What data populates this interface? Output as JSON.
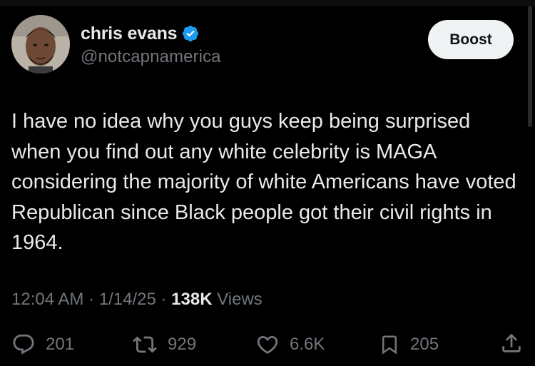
{
  "author": {
    "display_name": "chris evans",
    "handle": "@notcapnamerica",
    "verified": true,
    "verified_color": "#1d9bf0"
  },
  "boost_button": {
    "label": "Boost"
  },
  "tweet": {
    "text": "I have no idea why you guys keep being surprised when you find out any white celebrity is MAGA considering the majority of white Americans have voted Republican since Black people got their civil rights in 1964."
  },
  "meta": {
    "time": "12:04 AM",
    "date": "1/14/25",
    "views_count": "138K",
    "views_label": "Views",
    "separator": "·"
  },
  "actions": {
    "replies": "201",
    "reposts": "929",
    "likes": "6.6K",
    "bookmarks": "205"
  },
  "icons": {
    "reply": "reply-icon",
    "repost": "repost-icon",
    "like": "heart-icon",
    "bookmark": "bookmark-icon",
    "share": "share-icon"
  },
  "colors": {
    "background": "#000000",
    "text_primary": "#e7e9ea",
    "text_secondary": "#71767b",
    "button_bg": "#eff3f4"
  }
}
